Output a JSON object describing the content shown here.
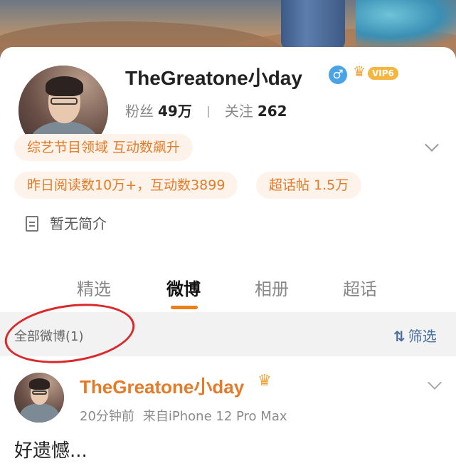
{
  "profile": {
    "name": "TheGreatone小day",
    "gender_symbol": "♂",
    "vip_badge": "VIP6",
    "fans_label": "粉丝",
    "fans_count": "49万",
    "following_label": "关注",
    "following_count": "262",
    "domain_tag": "综艺节目领域 互动数飙升",
    "stats_tag": "昨日阅读数10万+，互动数3899",
    "topic_tag": "超话帖 1.5万",
    "bio": "暂无简介"
  },
  "tabs": [
    "精选",
    "微博",
    "相册",
    "超话"
  ],
  "active_tab": "微博",
  "filter": {
    "label": "全部微博(1)",
    "button_label": "筛选"
  },
  "post": {
    "author": "TheGreatone小day",
    "time": "20分钟前",
    "source": "来自iPhone 12 Pro Max",
    "text": "好遗憾..."
  },
  "colors": {
    "accent_orange": "#e47b28",
    "tab_underline": "#ef7f1a",
    "filter_blue": "#4a6f9c",
    "annotation_red": "#d82a2a"
  }
}
